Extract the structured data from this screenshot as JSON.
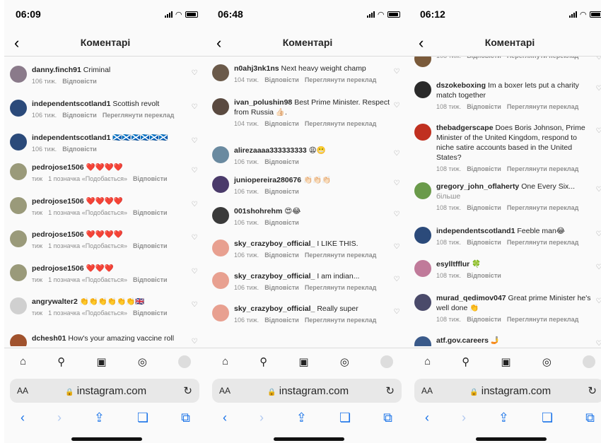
{
  "ui": {
    "header_title": "Коментарі",
    "reply": "Відповісти",
    "translate": "Переглянути переклад",
    "url": "instagram.com",
    "aa": "AA",
    "icons": [
      "home-icon",
      "search-icon",
      "reels-icon",
      "messenger-icon",
      "profile-avatar"
    ]
  },
  "phones": [
    {
      "time": "06:09",
      "comments": [
        {
          "user": "danny.finch91",
          "text": "Criminal",
          "time": "106 тиж.",
          "likes": "",
          "translate": false,
          "av": "#8a7a8a"
        },
        {
          "user": "independentscotland1",
          "text": "Scottish revolt",
          "time": "106 тиж.",
          "likes": "",
          "translate": true,
          "av": "#2b4a7a"
        },
        {
          "user": "independentscotland1",
          "text": "🏴󠁧󠁢󠁳󠁣󠁴󠁿🏴󠁧󠁢󠁳󠁣󠁴󠁿🏴󠁧󠁢󠁳󠁣󠁴󠁿🏴󠁧󠁢󠁳󠁣󠁴󠁿🏴󠁧󠁢󠁳󠁣󠁴󠁿🏴󠁧󠁢󠁳󠁣󠁴󠁿",
          "time": "106 тиж.",
          "likes": "",
          "translate": false,
          "av": "#2b4a7a"
        },
        {
          "user": "pedrojose1506",
          "text": "❤️❤️❤️❤️",
          "time": "тиж",
          "likes": "1 позначка «Подобається»",
          "translate": false,
          "av": "#9a9a7a"
        },
        {
          "user": "pedrojose1506",
          "text": "❤️❤️❤️❤️",
          "time": "тиж",
          "likes": "1 позначка «Подобається»",
          "translate": false,
          "av": "#9a9a7a"
        },
        {
          "user": "pedrojose1506",
          "text": "❤️❤️❤️❤️",
          "time": "тиж",
          "likes": "1 позначка «Подобається»",
          "translate": false,
          "av": "#9a9a7a"
        },
        {
          "user": "pedrojose1506",
          "text": "❤️❤️❤️",
          "time": "тиж",
          "likes": "1 позначка «Подобається»",
          "translate": false,
          "av": "#9a9a7a"
        },
        {
          "user": "angrywalter2",
          "text": "👏👏👏👏👏👏🇬🇧",
          "time": "тиж",
          "likes": "1 позначка «Подобається»",
          "translate": false,
          "av": "#d0d0d0"
        },
        {
          "user": "dchesh01",
          "text": "How's your amazing vaccine roll",
          "time": "",
          "likes": "",
          "translate": false,
          "av": "#a0522d"
        }
      ]
    },
    {
      "time": "06:48",
      "comments": [
        {
          "user": "n0ahj3nk1ns",
          "text": "Next heavy weight champ",
          "time": "104 тиж.",
          "likes": "",
          "translate": true,
          "av": "#6b5a4a"
        },
        {
          "user": "ivan_polushin98",
          "text": "Best Prime Minister. Respect from Russia 👍🏻.",
          "time": "104 тиж.",
          "likes": "",
          "translate": true,
          "av": "#5a4a40"
        },
        {
          "user": "alirezaaaa333333333",
          "text": "😩😬",
          "time": "106 тиж.",
          "likes": "",
          "translate": false,
          "av": "#6a8aa0"
        },
        {
          "user": "juniopereira280676",
          "text": "👏🏻👏🏻👏🏻",
          "time": "106 тиж.",
          "likes": "",
          "translate": false,
          "av": "#4a3a6a"
        },
        {
          "user": "001shohrehm",
          "text": "😍😂",
          "time": "106 тиж.",
          "likes": "",
          "translate": false,
          "av": "#3a3a3a"
        },
        {
          "user": "sky_crazyboy_official_",
          "text": "I LIKE THIS.",
          "time": "106 тиж.",
          "likes": "",
          "translate": true,
          "av": "#e8a090"
        },
        {
          "user": "sky_crazyboy_official_",
          "text": "I am indian...",
          "time": "106 тиж.",
          "likes": "",
          "translate": true,
          "av": "#e8a090"
        },
        {
          "user": "sky_crazyboy_official_",
          "text": "Really super",
          "time": "106 тиж.",
          "likes": "",
          "translate": true,
          "av": "#e8a090"
        }
      ]
    },
    {
      "time": "06:12",
      "comments": [
        {
          "user": "",
          "text": "",
          "time": "108 тиж.",
          "likes": "",
          "translate": true,
          "av": "#7a5a3a"
        },
        {
          "user": "dszokeboxing",
          "text": "Im a boxer lets put a charity match together",
          "time": "108 тиж.",
          "likes": "",
          "translate": true,
          "av": "#2a2a2a"
        },
        {
          "user": "thebadgerscape",
          "text": "Does Boris Johnson, Prime Minister of the United Kingdom, respond to niche satire accounts based in the United States?",
          "time": "108 тиж.",
          "likes": "",
          "translate": true,
          "av": "#c03020"
        },
        {
          "user": "gregory_john_oflaherty",
          "text": "One Every Six...",
          "more": "більше",
          "time": "108 тиж.",
          "likes": "",
          "translate": true,
          "av": "#6a9a4a"
        },
        {
          "user": "independentscotland1",
          "text": "Feeble man😂",
          "time": "108 тиж.",
          "likes": "",
          "translate": true,
          "av": "#2b4a7a"
        },
        {
          "user": "esylltfflur",
          "text": "🍀",
          "time": "108 тиж.",
          "likes": "",
          "translate": false,
          "av": "#c07a9a"
        },
        {
          "user": "murad_qedimov047",
          "text": "Great prime Minister he's well done 👏",
          "time": "108 тиж.",
          "likes": "",
          "translate": true,
          "av": "#4a4a6a"
        },
        {
          "user": "atf.gov.careers",
          "text": "🤳",
          "time": "",
          "likes": "",
          "translate": false,
          "av": "#3a5a8a"
        }
      ]
    }
  ]
}
